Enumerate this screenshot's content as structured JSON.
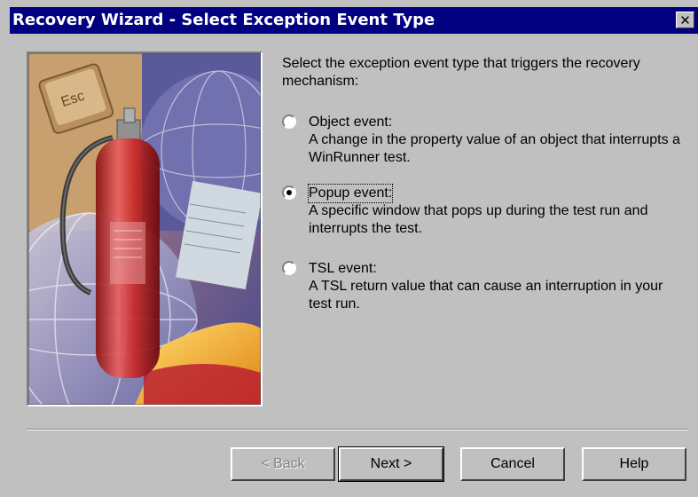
{
  "window": {
    "title": "Recovery Wizard - Select Exception Event Type",
    "close_symbol": "✕"
  },
  "intro": "Select the exception event type that triggers the recovery mechanism:",
  "options": [
    {
      "label": "Object event:",
      "description": "A change in the property value of an object that interrupts a WinRunner test.",
      "selected": false
    },
    {
      "label": "Popup event:",
      "description": "A specific window that pops up during the test run and interrupts the test.",
      "selected": true
    },
    {
      "label": "TSL event:",
      "description": "A TSL return value that can cause an interruption in your test run.",
      "selected": false
    }
  ],
  "buttons": {
    "back": "< Back",
    "next": "Next >",
    "cancel": "Cancel",
    "help": "Help"
  },
  "picture": {
    "key_caption": "Esc",
    "icon": "fire-extinguisher-illustration"
  }
}
